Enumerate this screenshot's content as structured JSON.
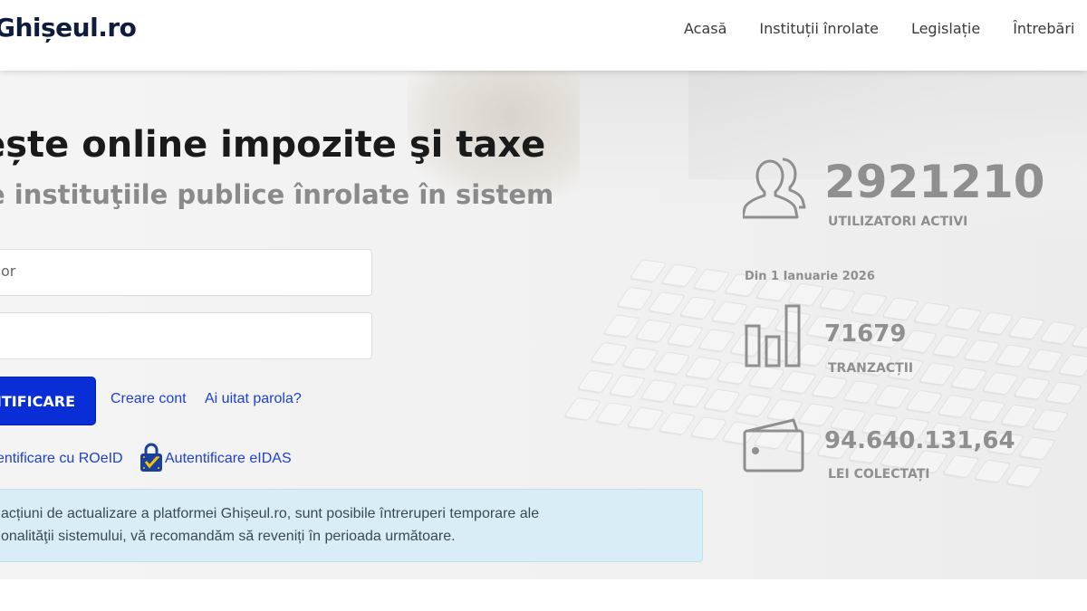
{
  "header": {
    "logo": "Ghișeul.ro",
    "nav": [
      "Acasă",
      "Instituții înrolate",
      "Legislație",
      "Întrebări"
    ]
  },
  "hero": {
    "headline": "tește online impozite şi taxe",
    "subline": "e instituţiile publice înrolate în sistem"
  },
  "login": {
    "username_value": "or",
    "password_value": "",
    "login_button": "NTIFICARE",
    "create_account": "Creare cont",
    "forgot_password": "Ai uitat parola?",
    "roeid": "entificare cu ROeID",
    "eidas": "Autentificare eIDAS"
  },
  "alert": {
    "line1": "acțiuni de actualizare a platformei Ghișeul.ro, sunt posibile întreruperi temporare ale",
    "line2": "onalităţii sistemului, vă recomandăm să reveniți în perioada următoare."
  },
  "stats": {
    "users_count": "2921210",
    "users_label": "UTILIZATORI ACTIVI",
    "since": "Din 1 Ianuarie 2026",
    "transactions_count": "71679",
    "transactions_label": "TRANZACȚII",
    "collected_amount": "94.640.131,64",
    "collected_label": "LEI COLECTAȚI"
  },
  "colors": {
    "primary_button": "#0a2ed6",
    "link": "#1c3fd8",
    "alert_bg": "#d8edf5",
    "stat_gray": "#8f8f8f"
  },
  "icons": [
    "users-icon",
    "bar-chart-icon",
    "wallet-icon",
    "eidas-lock-icon"
  ]
}
